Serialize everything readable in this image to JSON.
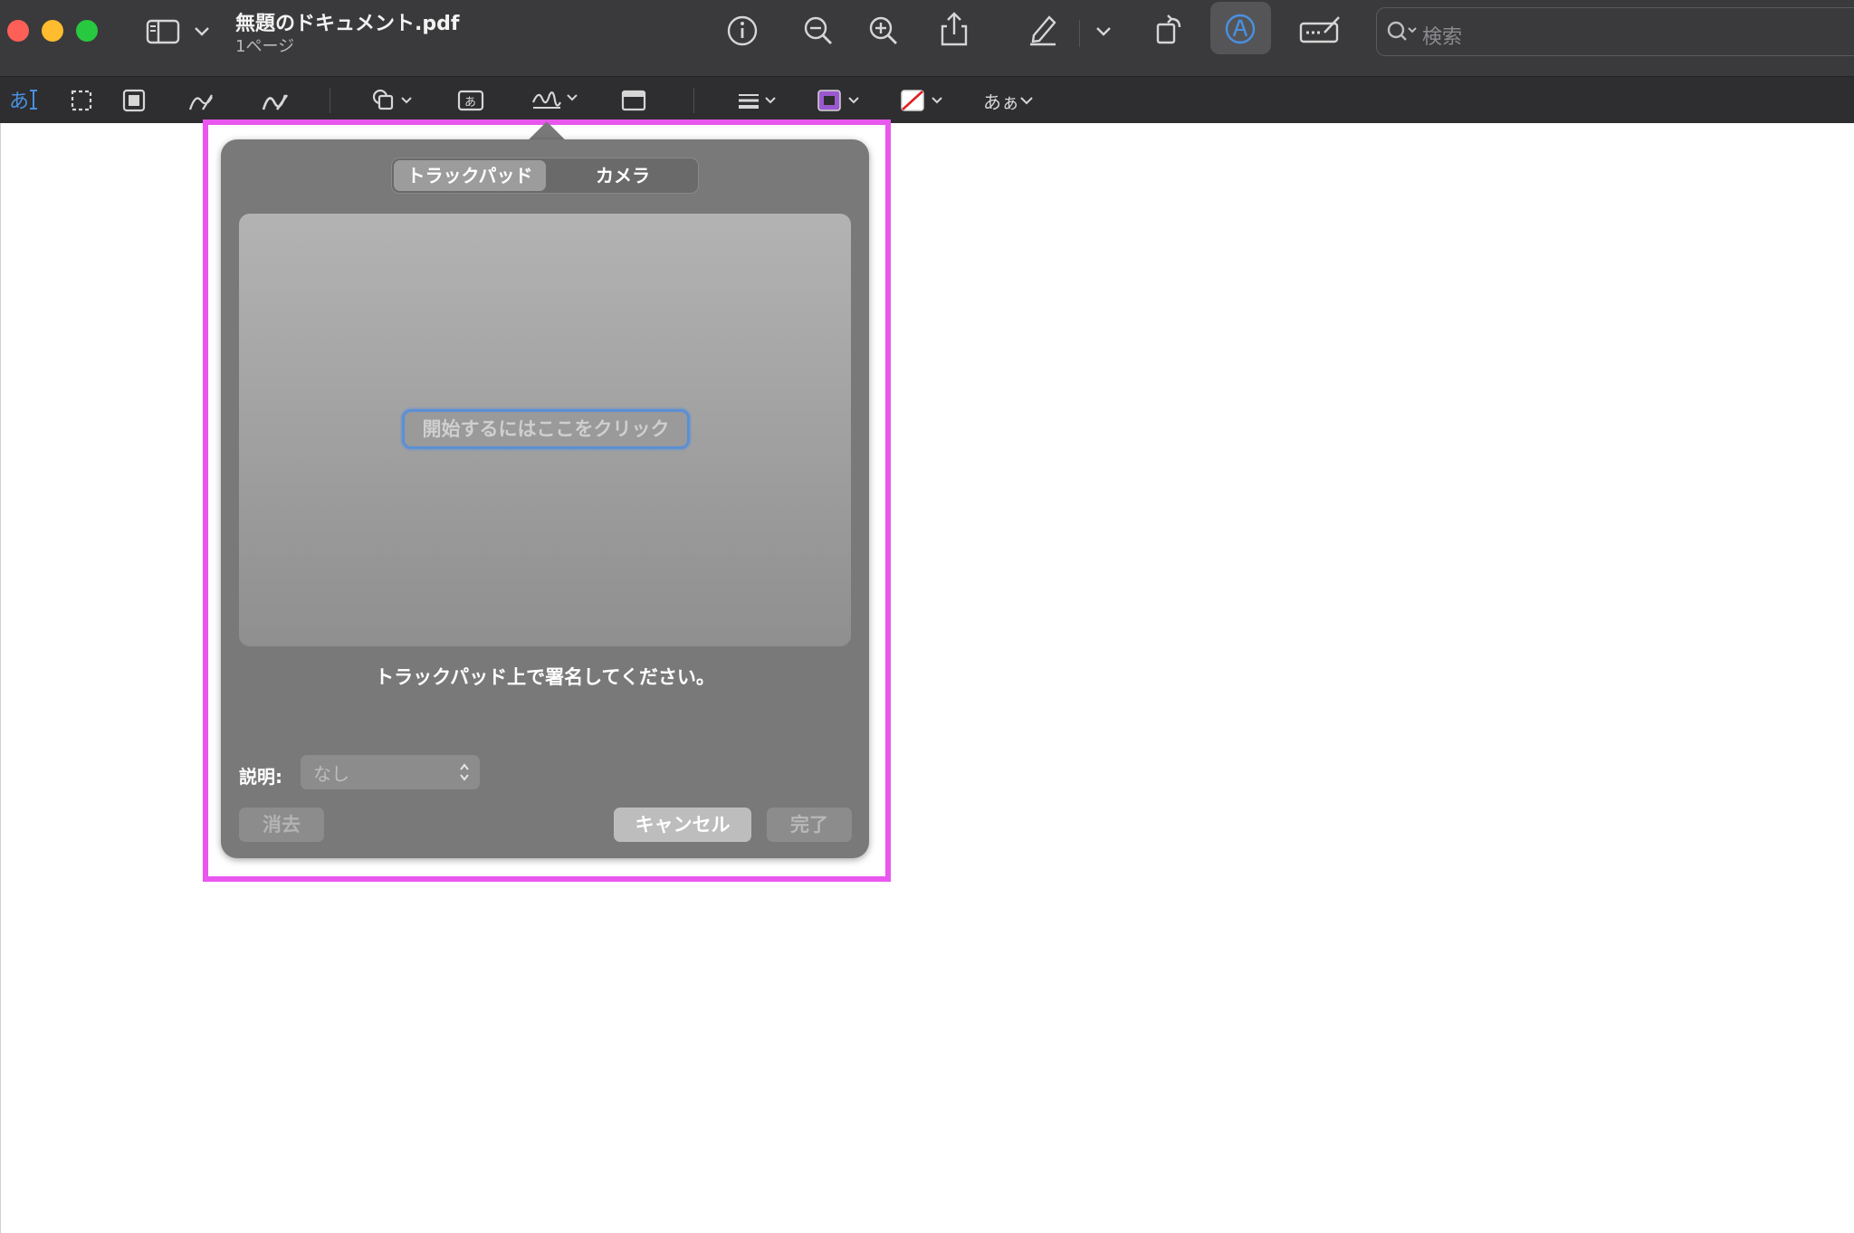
{
  "window": {
    "title": "無題のドキュメント.pdf",
    "subtitle": "1ページ"
  },
  "toolbar": {
    "icons": [
      "sidebar-icon",
      "chevron-down-icon",
      "info-icon",
      "zoom-out-icon",
      "zoom-in-icon",
      "share-icon",
      "highlight-pen-icon",
      "chevron-down-icon",
      "rotate-icon",
      "markup-icon",
      "form-filling-icon",
      "search-icon"
    ],
    "search_placeholder": "検索"
  },
  "markup": {
    "text_select": "あ",
    "font_label": "あぁ",
    "accent_color": "#9b59d0",
    "icons": [
      "text-selection-icon",
      "rect-select-icon",
      "redact-icon",
      "sketch-icon",
      "draw-icon",
      "shapes-icon",
      "text-box-icon",
      "signature-icon",
      "note-icon",
      "line-style-icon",
      "border-color-icon",
      "fill-color-icon",
      "text-style-icon"
    ]
  },
  "signature_popover": {
    "tab_trackpad": "トラックパッド",
    "tab_camera": "カメラ",
    "start_button": "開始するにはここをクリック",
    "hint": "トラックパッド上で署名してください。",
    "description_label": "説明:",
    "description_value": "なし",
    "clear_button": "消去",
    "cancel_button": "キャンセル",
    "done_button": "完了"
  },
  "highlight_color": "#e957ee"
}
